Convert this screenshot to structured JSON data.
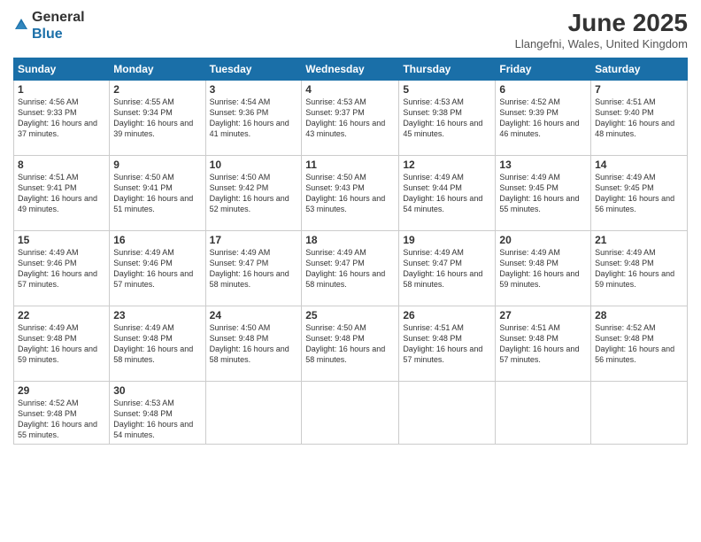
{
  "logo": {
    "general": "General",
    "blue": "Blue"
  },
  "header": {
    "title": "June 2025",
    "location": "Llangefni, Wales, United Kingdom"
  },
  "weekdays": [
    "Sunday",
    "Monday",
    "Tuesday",
    "Wednesday",
    "Thursday",
    "Friday",
    "Saturday"
  ],
  "weeks": [
    [
      {
        "day": "1",
        "sunrise": "4:56 AM",
        "sunset": "9:33 PM",
        "daylight": "16 hours and 37 minutes."
      },
      {
        "day": "2",
        "sunrise": "4:55 AM",
        "sunset": "9:34 PM",
        "daylight": "16 hours and 39 minutes."
      },
      {
        "day": "3",
        "sunrise": "4:54 AM",
        "sunset": "9:36 PM",
        "daylight": "16 hours and 41 minutes."
      },
      {
        "day": "4",
        "sunrise": "4:53 AM",
        "sunset": "9:37 PM",
        "daylight": "16 hours and 43 minutes."
      },
      {
        "day": "5",
        "sunrise": "4:53 AM",
        "sunset": "9:38 PM",
        "daylight": "16 hours and 45 minutes."
      },
      {
        "day": "6",
        "sunrise": "4:52 AM",
        "sunset": "9:39 PM",
        "daylight": "16 hours and 46 minutes."
      },
      {
        "day": "7",
        "sunrise": "4:51 AM",
        "sunset": "9:40 PM",
        "daylight": "16 hours and 48 minutes."
      }
    ],
    [
      {
        "day": "8",
        "sunrise": "4:51 AM",
        "sunset": "9:41 PM",
        "daylight": "16 hours and 49 minutes."
      },
      {
        "day": "9",
        "sunrise": "4:50 AM",
        "sunset": "9:41 PM",
        "daylight": "16 hours and 51 minutes."
      },
      {
        "day": "10",
        "sunrise": "4:50 AM",
        "sunset": "9:42 PM",
        "daylight": "16 hours and 52 minutes."
      },
      {
        "day": "11",
        "sunrise": "4:50 AM",
        "sunset": "9:43 PM",
        "daylight": "16 hours and 53 minutes."
      },
      {
        "day": "12",
        "sunrise": "4:49 AM",
        "sunset": "9:44 PM",
        "daylight": "16 hours and 54 minutes."
      },
      {
        "day": "13",
        "sunrise": "4:49 AM",
        "sunset": "9:45 PM",
        "daylight": "16 hours and 55 minutes."
      },
      {
        "day": "14",
        "sunrise": "4:49 AM",
        "sunset": "9:45 PM",
        "daylight": "16 hours and 56 minutes."
      }
    ],
    [
      {
        "day": "15",
        "sunrise": "4:49 AM",
        "sunset": "9:46 PM",
        "daylight": "16 hours and 57 minutes."
      },
      {
        "day": "16",
        "sunrise": "4:49 AM",
        "sunset": "9:46 PM",
        "daylight": "16 hours and 57 minutes."
      },
      {
        "day": "17",
        "sunrise": "4:49 AM",
        "sunset": "9:47 PM",
        "daylight": "16 hours and 58 minutes."
      },
      {
        "day": "18",
        "sunrise": "4:49 AM",
        "sunset": "9:47 PM",
        "daylight": "16 hours and 58 minutes."
      },
      {
        "day": "19",
        "sunrise": "4:49 AM",
        "sunset": "9:47 PM",
        "daylight": "16 hours and 58 minutes."
      },
      {
        "day": "20",
        "sunrise": "4:49 AM",
        "sunset": "9:48 PM",
        "daylight": "16 hours and 59 minutes."
      },
      {
        "day": "21",
        "sunrise": "4:49 AM",
        "sunset": "9:48 PM",
        "daylight": "16 hours and 59 minutes."
      }
    ],
    [
      {
        "day": "22",
        "sunrise": "4:49 AM",
        "sunset": "9:48 PM",
        "daylight": "16 hours and 59 minutes."
      },
      {
        "day": "23",
        "sunrise": "4:49 AM",
        "sunset": "9:48 PM",
        "daylight": "16 hours and 58 minutes."
      },
      {
        "day": "24",
        "sunrise": "4:50 AM",
        "sunset": "9:48 PM",
        "daylight": "16 hours and 58 minutes."
      },
      {
        "day": "25",
        "sunrise": "4:50 AM",
        "sunset": "9:48 PM",
        "daylight": "16 hours and 58 minutes."
      },
      {
        "day": "26",
        "sunrise": "4:51 AM",
        "sunset": "9:48 PM",
        "daylight": "16 hours and 57 minutes."
      },
      {
        "day": "27",
        "sunrise": "4:51 AM",
        "sunset": "9:48 PM",
        "daylight": "16 hours and 57 minutes."
      },
      {
        "day": "28",
        "sunrise": "4:52 AM",
        "sunset": "9:48 PM",
        "daylight": "16 hours and 56 minutes."
      }
    ],
    [
      {
        "day": "29",
        "sunrise": "4:52 AM",
        "sunset": "9:48 PM",
        "daylight": "16 hours and 55 minutes."
      },
      {
        "day": "30",
        "sunrise": "4:53 AM",
        "sunset": "9:48 PM",
        "daylight": "16 hours and 54 minutes."
      },
      null,
      null,
      null,
      null,
      null
    ]
  ]
}
